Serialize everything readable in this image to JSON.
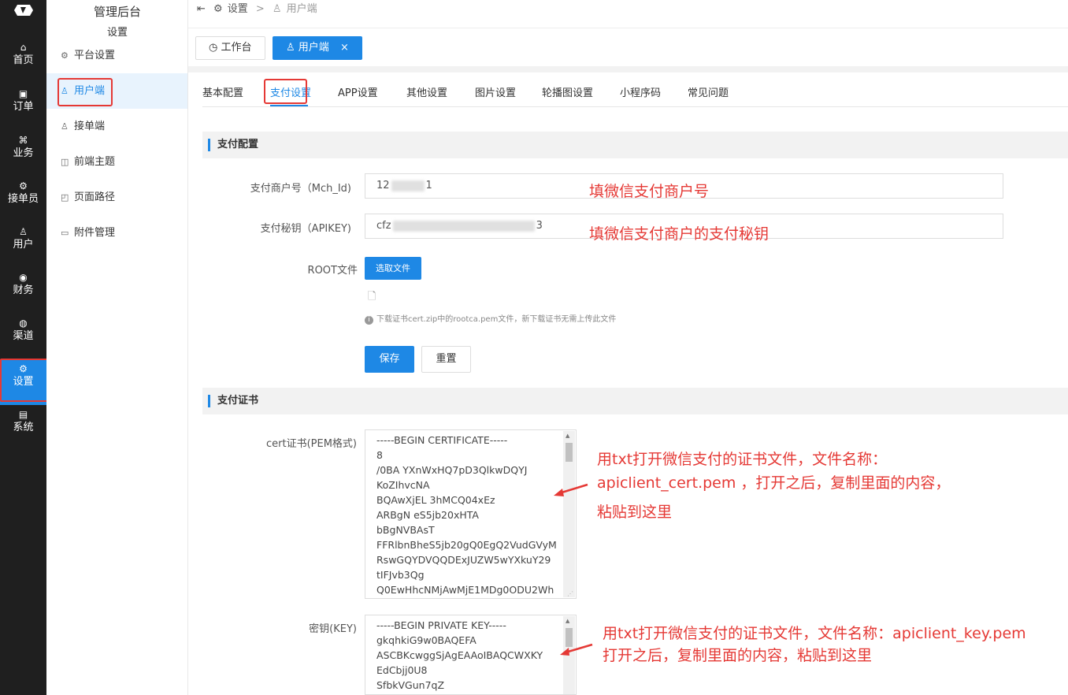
{
  "rail": {
    "items": [
      {
        "label": "首页",
        "icon": "home-icon",
        "glyph": "⌂"
      },
      {
        "label": "订单",
        "icon": "order-icon",
        "glyph": "▣"
      },
      {
        "label": "业务",
        "icon": "business-icon",
        "glyph": "⌘"
      },
      {
        "label": "接单员",
        "icon": "bike-icon",
        "glyph": "⚙"
      },
      {
        "label": "用户",
        "icon": "user-icon",
        "glyph": "♙"
      },
      {
        "label": "财务",
        "icon": "finance-icon",
        "glyph": "◉"
      },
      {
        "label": "渠道",
        "icon": "channel-icon",
        "glyph": "◍"
      },
      {
        "label": "设置",
        "icon": "settings-icon",
        "glyph": "⚙"
      },
      {
        "label": "系统",
        "icon": "system-icon",
        "glyph": "▤"
      }
    ],
    "active_index": 7
  },
  "sidebar": {
    "title": "管理后台",
    "subtitle": "设置",
    "items": [
      {
        "label": "平台设置",
        "glyph": "⚙"
      },
      {
        "label": "用户端",
        "glyph": "♙"
      },
      {
        "label": "接单端",
        "glyph": "♙"
      },
      {
        "label": "前端主题",
        "glyph": "◫"
      },
      {
        "label": "页面路径",
        "glyph": "◰"
      },
      {
        "label": "附件管理",
        "glyph": "▭"
      }
    ],
    "active_index": 1
  },
  "breadcrumb": {
    "root": "设置",
    "sep": ">",
    "current": "用户端"
  },
  "page_tabs": [
    {
      "label": "工作台",
      "glyph": "◷"
    },
    {
      "label": "用户端",
      "glyph": "♙",
      "close": "×"
    }
  ],
  "sub_tabs": [
    "基本配置",
    "支付设置",
    "APP设置",
    "其他设置",
    "图片设置",
    "轮播图设置",
    "小程序码",
    "常见问题"
  ],
  "sub_tabs_active": 1,
  "payment_config": {
    "section_title": "支付配置",
    "mch_id_label": "支付商户号（Mch_Id)",
    "mch_id_prefix": "12",
    "mch_id_suffix": "1",
    "apikey_label": "支付秘钥（APIKEY)",
    "apikey_prefix": "cfz",
    "apikey_suffix": "3",
    "root_label": "ROOT文件",
    "choose_file": "选取文件",
    "tip": "下载证书cert.zip中的rootca.pem文件，新下载证书无需上传此文件",
    "save": "保存",
    "reset": "重置"
  },
  "cert_section": {
    "section_title": "支付证书",
    "cert_label": "cert证书(PEM格式)",
    "cert_lines": [
      "-----BEGIN CERTIFICATE-----",
      "8",
      "/0BA          YXnWxHQ7pD3QlkwDQYJ",
      "KoZIhvcNA",
      "BQAwXjEL                 3hMCQ04xEz",
      "ARBgN                    eS5jb20xHTA",
      "bBgNVBAsT",
      "FFRlbnBheS5jb20gQ0EgQ2VudGVyM",
      "RswGQYDVQQDExJUZW5wYXkuY29",
      "tIFJvb3Qg",
      "Q0EwHhcNMjAwMjE1MDg0ODU2Wh"
    ],
    "key_label": "密钥(KEY)",
    "key_lines": [
      "-----BEGIN PRIVATE KEY-----",
      "                 gkqhkiG9w0BAQEFA",
      "ASCBKcwggSjAgEAAoIBAQCWXKY",
      "EdCbjj0U8",
      "                 SfbkVGun7qZ"
    ]
  },
  "annotations": {
    "mch_note": "填微信支付商户号",
    "key_note": "填微信支付商户的支付秘钥",
    "cert_note_1": "用txt打开微信支付的证书文件，文件名称：",
    "cert_note_2": "apiclient_cert.pem ，打开之后，复制里面的内容，",
    "cert_note_3": "粘贴到这里",
    "key_file_note_1": "用txt打开微信支付的证书文件，文件名称：apiclient_key.pem",
    "key_file_note_2": "打开之后，复制里面的内容，粘贴到这里"
  },
  "colors": {
    "primary": "#1e88e5",
    "annotation": "#e53935",
    "rail": "#1f1f1f"
  }
}
